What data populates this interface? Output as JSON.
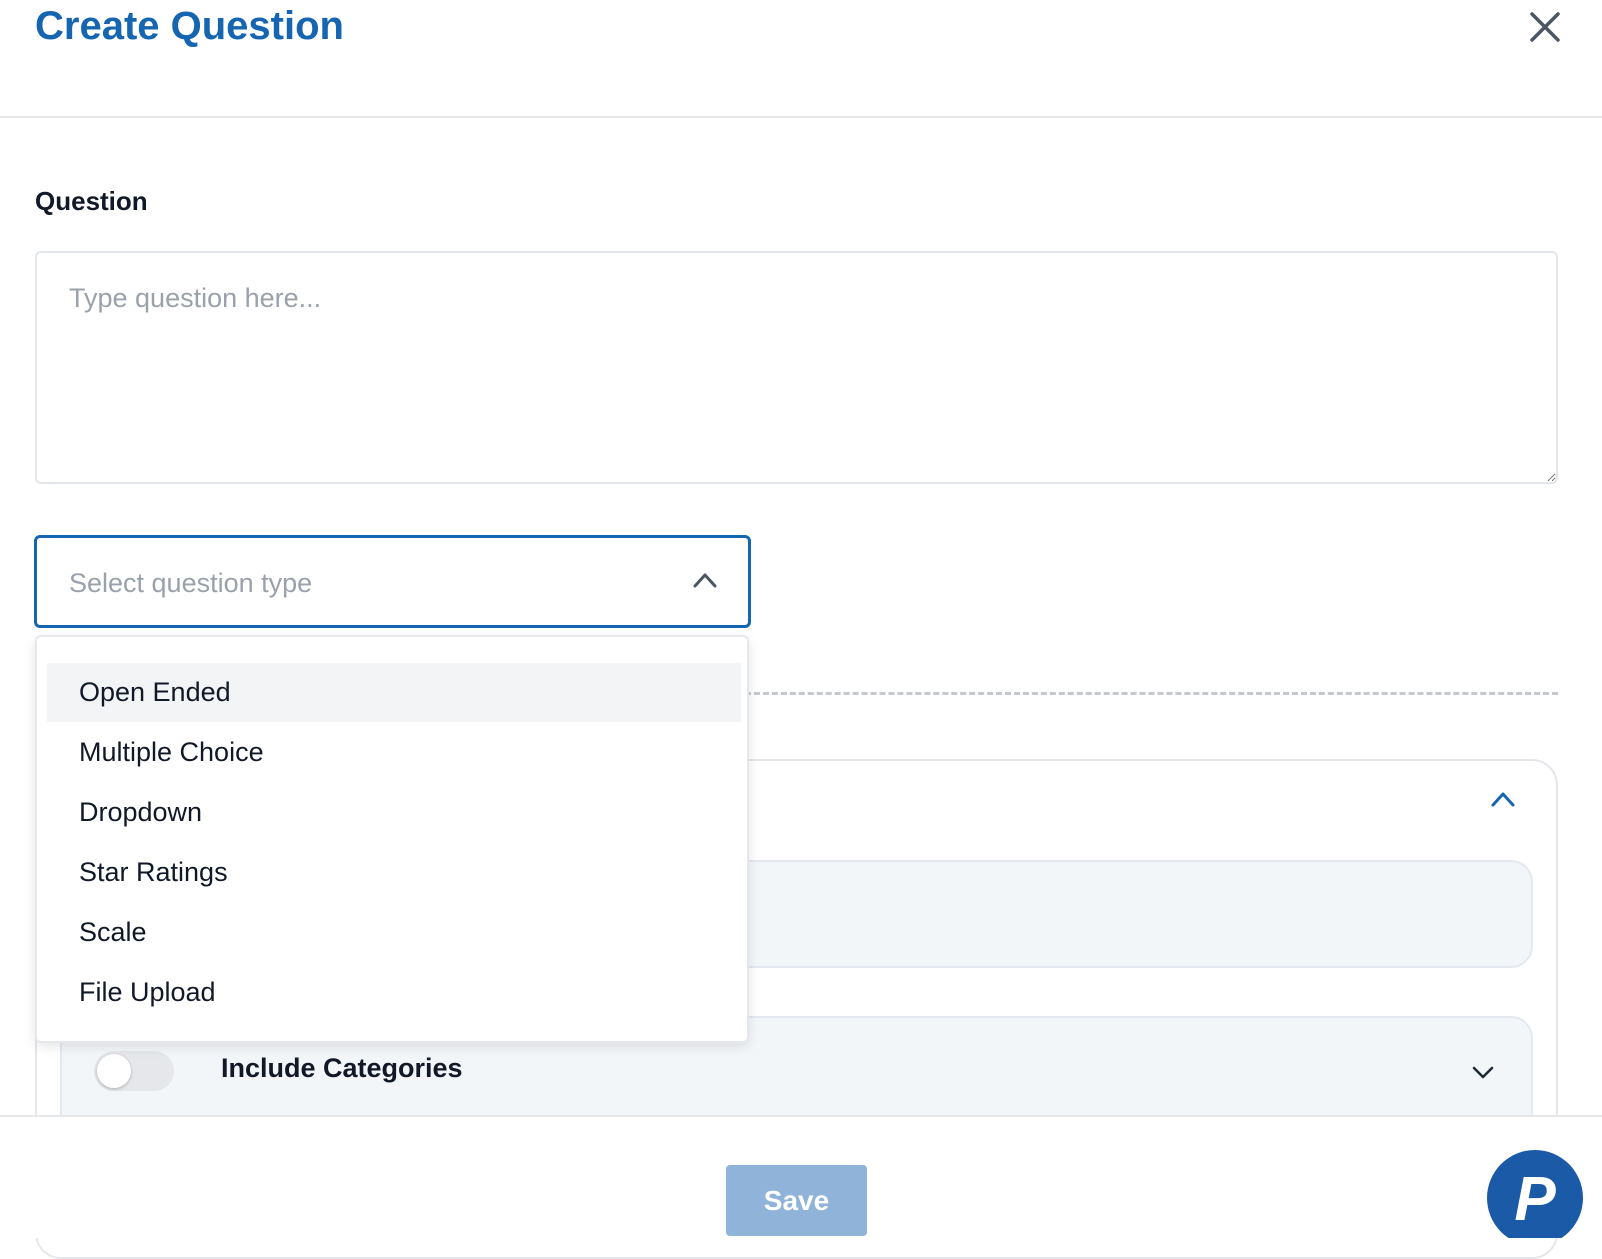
{
  "header": {
    "title": "Create Question",
    "close_icon": "close-icon"
  },
  "question": {
    "label": "Question",
    "value": "",
    "placeholder": "Type question here..."
  },
  "question_type": {
    "placeholder": "Select question type",
    "options": [
      {
        "label": "Open Ended",
        "highlighted": true
      },
      {
        "label": "Multiple Choice",
        "highlighted": false
      },
      {
        "label": "Dropdown",
        "highlighted": false
      },
      {
        "label": "Star Ratings",
        "highlighted": false
      },
      {
        "label": "Scale",
        "highlighted": false
      },
      {
        "label": "File Upload",
        "highlighted": false
      }
    ]
  },
  "categories": {
    "label": "Include Categories",
    "enabled": false
  },
  "footer": {
    "save_label": "Save"
  },
  "fab": {
    "letter": "P"
  },
  "colors": {
    "accent": "#1565b0",
    "save_disabled": "#8fb3d9",
    "fab": "#1a5aa6"
  }
}
